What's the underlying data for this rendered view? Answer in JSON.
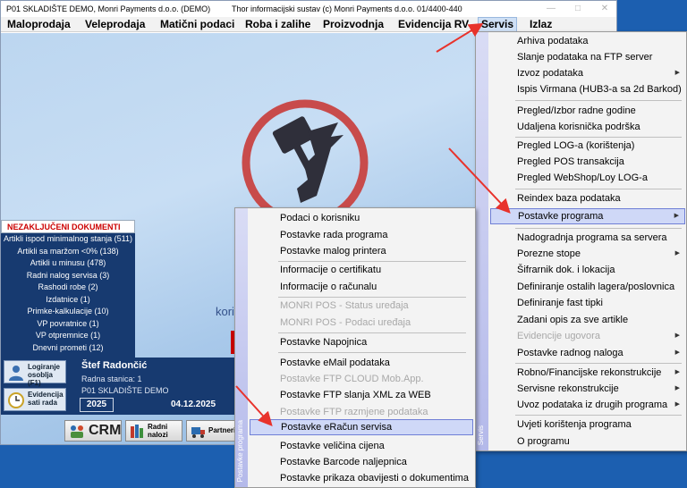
{
  "window": {
    "title": "P01 SKLADIŠTE DEMO, Monri Payments d.o.o. (DEMO)",
    "center_title": "Thor informacijski sustav (c) Monri Payments d.o.o. 01/4400-440",
    "min_glyph": "—",
    "max_glyph": "□",
    "close_glyph": "✕"
  },
  "menubar": [
    {
      "label": "Maloprodaja"
    },
    {
      "label": "Veleprodaja"
    },
    {
      "label": "Matični podaci"
    },
    {
      "label": "Roba i zalihe"
    },
    {
      "label": "Proizvodnja"
    },
    {
      "label": "Evidencija RV"
    },
    {
      "label": "Servis"
    },
    {
      "label": "Izlaz"
    }
  ],
  "workspace": {
    "text": "kori"
  },
  "nezakljuceni": {
    "title": "NEZAKLJUČENI DOKUMENTI",
    "items": [
      "Artikli ispod minimalnog stanja (511)",
      "Artikli sa maržom <0% (138)",
      "Artikli u minusu (478)",
      "Radni nalog servisa (3)",
      "Rashodi robe (2)",
      "Izdatnice (1)",
      "Primke-kalkulacije (10)",
      "VP povratnice (1)",
      "VP otpremnice (1)",
      "Dnevni prometi (12)"
    ]
  },
  "user": {
    "login_label": "Logiranje osoblja (F1)",
    "evidencija_label": "Evidencija sati rada",
    "name": "Štef Radončić",
    "station": "Radna stanica: 1",
    "company": "P01 SKLADIŠTE DEMO",
    "year": "2025",
    "date": "04.12.2025"
  },
  "bottom_buttons": {
    "crm": "CRM",
    "radni_nalozi": "Radni nalozi",
    "partneri": "Partneri"
  },
  "servis_menu": {
    "side_label": "Servis",
    "items": [
      {
        "label": "Arhiva podataka"
      },
      {
        "label": "Slanje podataka na FTP server"
      },
      {
        "label": "Izvoz podataka",
        "submenu": "▶"
      },
      {
        "label": "Ispis Virmana (HUB3-a sa 2d Barkod)"
      },
      {
        "label": "Pregled/Izbor radne godine"
      },
      {
        "label": "Udaljena korisnička podrška"
      },
      {
        "label": "Pregled LOG-a (korištenja)"
      },
      {
        "label": "Pregled POS transakcija"
      },
      {
        "label": "Pregled WebShop/Loy LOG-a"
      },
      {
        "label": "Reindex baza podataka"
      },
      {
        "label": "Postavke programa",
        "submenu": "▶"
      },
      {
        "label": "Nadogradnja programa sa servera"
      },
      {
        "label": "Porezne stope",
        "submenu": "▶"
      },
      {
        "label": "Šifrarnik dok. i lokacija"
      },
      {
        "label": "Definiranje ostalih lagera/poslovnica"
      },
      {
        "label": "Definiranje fast tipki"
      },
      {
        "label": "Zadani opis za sve artikle"
      },
      {
        "label": "Evidencije ugovora",
        "submenu": "▶",
        "disabled": true
      },
      {
        "label": "Postavke radnog naloga",
        "submenu": "▶"
      },
      {
        "label": "Robno/Financijske rekonstrukcije",
        "submenu": "▶"
      },
      {
        "label": "Servisne rekonstrukcije",
        "submenu": "▶"
      },
      {
        "label": "Uvoz podataka iz drugih programa",
        "submenu": "▶"
      },
      {
        "label": "Uvjeti korištenja programa"
      },
      {
        "label": "O programu"
      }
    ]
  },
  "postavke_menu": {
    "side_label": "Postavke programa",
    "items": [
      {
        "label": "Podaci o korisniku"
      },
      {
        "label": "Postavke rada programa"
      },
      {
        "label": "Postavke malog printera"
      },
      {
        "label": "Informacije o certifikatu"
      },
      {
        "label": "Informacije o računalu"
      },
      {
        "label": "MONRI POS - Status uređaja",
        "disabled": true
      },
      {
        "label": "MONRI POS - Podaci uređaja",
        "disabled": true
      },
      {
        "label": "Postavke Napojnica"
      },
      {
        "label": "Postavke eMail podataka"
      },
      {
        "label": "Postavke FTP CLOUD Mob.App.",
        "disabled": true
      },
      {
        "label": "Postavke FTP slanja XML za WEB"
      },
      {
        "label": "Postavke FTP razmjene podataka",
        "disabled": true
      },
      {
        "label": "Postavke eRačun servisa"
      },
      {
        "label": "Postavke veličina cijena"
      },
      {
        "label": "Postavke Barcode naljepnica"
      },
      {
        "label": "Postavke prikaza obavijesti o dokumentima"
      }
    ]
  },
  "colors": {
    "desktop": "#1c5fb0",
    "dark_panel": "#173a70",
    "logo_ring": "#c84b4b",
    "highlight": "#cfd8f7",
    "arrow": "#e8322b"
  }
}
